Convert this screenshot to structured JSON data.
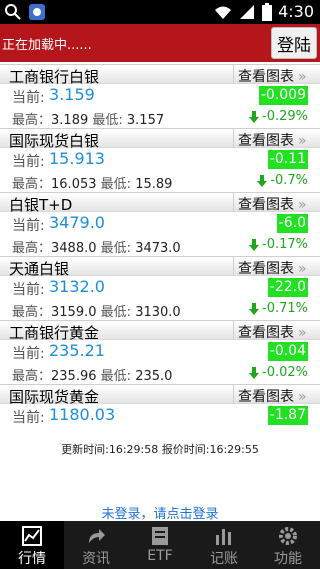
{
  "statusbar": {
    "time": "4:30"
  },
  "header": {
    "loading_text": "正在加载中......",
    "login_label": "登陆"
  },
  "chart_link_label": "查看图表",
  "chart_link_chevron": "»",
  "labels": {
    "current": "当前:",
    "high": "最高：",
    "low": "最低:"
  },
  "quotes": [
    {
      "name": "工商银行白银",
      "current": "3.159",
      "change": "-0.009",
      "high": "3.189",
      "low": "3.157",
      "pct": "-0.29%"
    },
    {
      "name": "国际现货白银",
      "current": "15.913",
      "change": "-0.11",
      "high": "16.053",
      "low": "15.89",
      "pct": "-0.7%"
    },
    {
      "name": "白银T+D",
      "current": "3479.0",
      "change": "-6.0",
      "high": "3488.0",
      "low": "3473.0",
      "pct": "-0.17%"
    },
    {
      "name": "天通白银",
      "current": "3132.0",
      "change": "-22.0",
      "high": "3159.0",
      "low": "3130.0",
      "pct": "-0.71%"
    },
    {
      "name": "工商银行黄金",
      "current": "235.21",
      "change": "-0.04",
      "high": "235.96",
      "low": "235.0",
      "pct": "-0.02%"
    },
    {
      "name": "国际现货黄金",
      "current": "1180.03",
      "change": "-1.87"
    }
  ],
  "update": {
    "text": "更新时间:16:29:58    报价时间:16:29:55"
  },
  "login_prompt": "未登录，请点击登录",
  "tabs": [
    {
      "label": "行情",
      "icon": "chart-icon"
    },
    {
      "label": "资讯",
      "icon": "share-arrow-icon"
    },
    {
      "label": "ETF",
      "icon": "book-icon"
    },
    {
      "label": "记账",
      "icon": "bars-icon"
    },
    {
      "label": "功能",
      "icon": "gear-icon"
    }
  ],
  "colors": {
    "header": "#b5161b",
    "change_badge": "#22e022",
    "price": "#1e8ed8",
    "pct_down": "#1ea81e"
  }
}
